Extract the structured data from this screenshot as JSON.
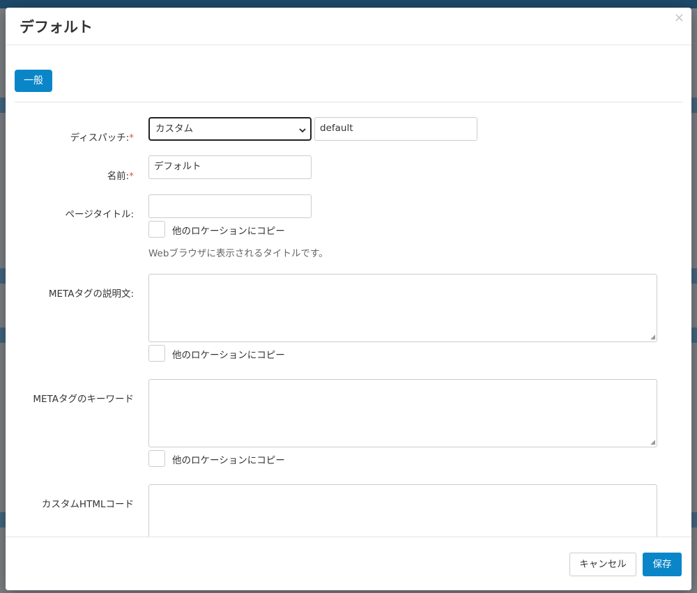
{
  "modal": {
    "title": "デフォルト",
    "close_icon": "×"
  },
  "tabs": [
    {
      "label": "一般",
      "active": true
    }
  ],
  "form": {
    "dispatch": {
      "label": "ディスパッチ:",
      "required_mark": "*",
      "select_value": "カスタム",
      "custom_value": "default"
    },
    "name": {
      "label": "名前:",
      "required_mark": "*",
      "value": "デフォルト"
    },
    "page_title": {
      "label": "ページタイトル:",
      "value": "",
      "copy_label": "他のロケーションにコピー",
      "help": "Webブラウザに表示されるタイトルです。"
    },
    "meta_description": {
      "label": "METAタグの説明文:",
      "value": "",
      "copy_label": "他のロケーションにコピー"
    },
    "meta_keywords": {
      "label": "METAタグのキーワード",
      "value": "",
      "copy_label": "他のロケーションにコピー"
    },
    "custom_html": {
      "label": "カスタムHTMLコード",
      "value": ""
    }
  },
  "footer": {
    "cancel_label": "キャンセル",
    "save_label": "保存"
  },
  "colors": {
    "primary": "#0a86c8",
    "required": "#d9534f"
  }
}
